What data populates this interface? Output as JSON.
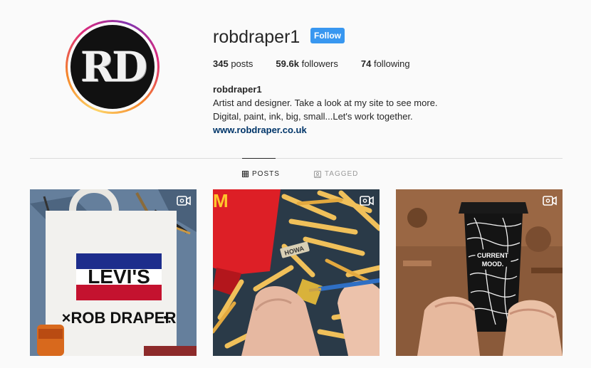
{
  "profile": {
    "avatar_monogram": "RD",
    "username": "robdraper1",
    "follow_label": "Follow",
    "stats": {
      "posts_count": "345",
      "posts_label": "posts",
      "followers_count": "59.6k",
      "followers_label": "followers",
      "following_count": "74",
      "following_label": "following"
    },
    "bio": {
      "name": "robdraper1",
      "line1": "Artist and designer. Take a look at my site to see more.",
      "line2": "Digital, paint, ink, big, small...Let's work together.",
      "link": "www.robdraper.co.uk"
    }
  },
  "tabs": [
    {
      "label": "POSTS",
      "icon": "grid-icon",
      "active": true
    },
    {
      "label": "TAGGED",
      "icon": "tagged-icon",
      "active": false
    }
  ],
  "posts": [
    {
      "type": "video",
      "logo_text": "LEVI'S",
      "caption_text": "×ROB DRAPER"
    },
    {
      "type": "video",
      "bag_letter": "M",
      "label_text": "HOWA"
    },
    {
      "type": "video",
      "cup_text_line1": "CURRENT",
      "cup_text_line2": "MOOD."
    }
  ],
  "colors": {
    "follow_button": "#3897f0",
    "link": "#003569",
    "levis_red": "#c4122f",
    "levis_blue": "#1d2d8c",
    "mcd_red": "#dd1f26",
    "mcd_yellow": "#ffc72c"
  }
}
